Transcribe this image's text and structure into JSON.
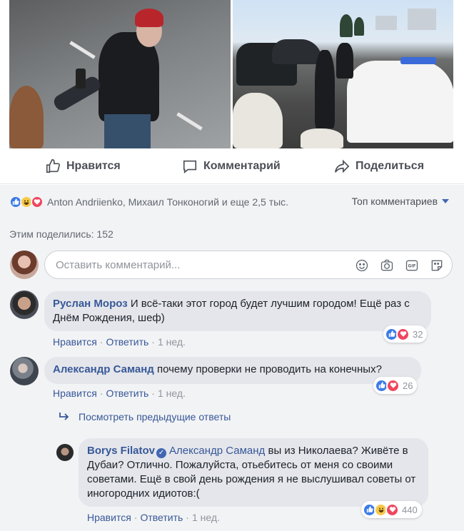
{
  "actions": {
    "like": "Нравится",
    "comment": "Комментарий",
    "share": "Поделиться"
  },
  "reactions": {
    "summary": "Anton Andriienko, Михаил Тонконогий и еще 2,5 тыс.",
    "sort": "Топ комментариев",
    "shares": "Этим поделились: 152"
  },
  "composer": {
    "placeholder": "Оставить комментарий..."
  },
  "comments": [
    {
      "author": "Руслан Мороз",
      "text": "И всё-таки этот город будет лучшим городом! Ещё раз с Днём Рождения, шеф)",
      "like": "Нравится",
      "reply": "Ответить",
      "time": "1 нед.",
      "reactions": "32"
    },
    {
      "author": "Александр Саманд",
      "text": "почему проверки не проводить на конечных?",
      "like": "Нравится",
      "reply": "Ответить",
      "time": "1 нед.",
      "reactions": "26",
      "view_prev": "Посмотреть предыдущие ответы",
      "reply_item": {
        "author": "Borys Filatov",
        "mention": "Александр Саманд",
        "text": "вы из Николаева? Живёте в Дубаи? Отлично. Пожалуйста, отьебитесь от меня со своими советами. Ещё в свой день рождения я не выслушивал советы от иногородних идиотов:(",
        "like": "Нравится",
        "reply": "Ответить",
        "time": "1 нед.",
        "reactions": "440"
      }
    }
  ],
  "colors": {
    "link": "#385898",
    "like_blue": "#3b7ae8",
    "love_red": "#f0455f",
    "haha_yellow": "#f7c94b"
  }
}
